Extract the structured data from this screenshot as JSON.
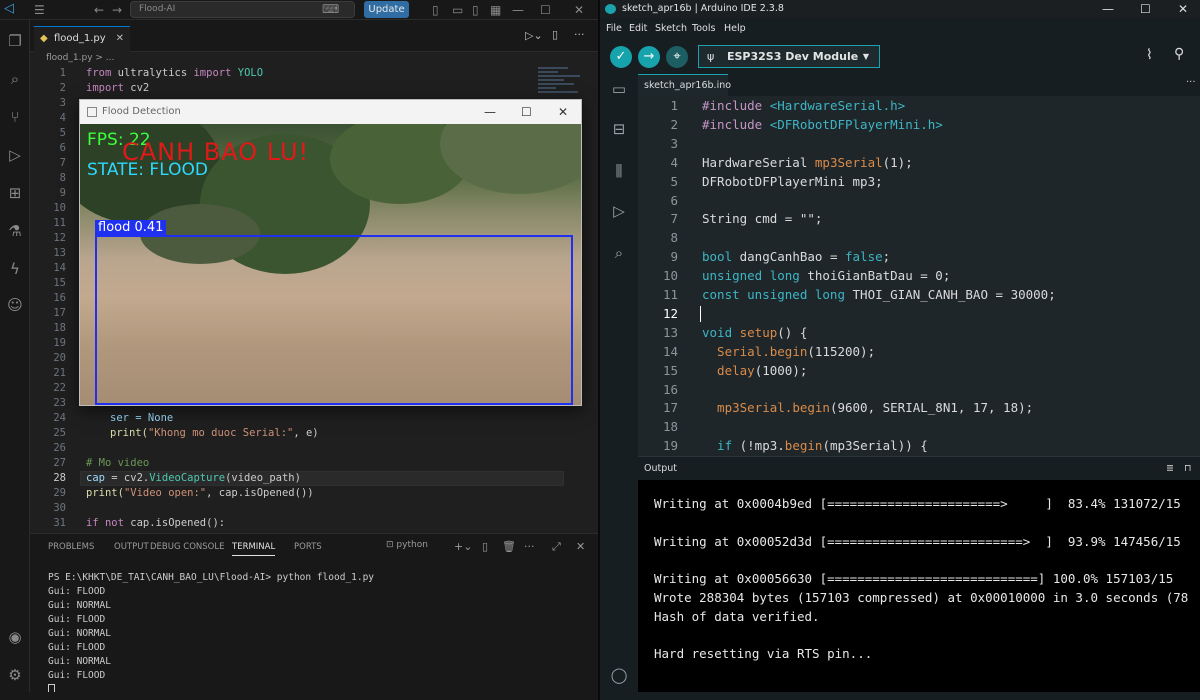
{
  "vscode": {
    "search_placeholder": "Flood-AI",
    "update_label": "Update",
    "tab_label": "flood_1.py",
    "breadcrumb": "flood_1.py > ...",
    "code_top": [
      {
        "n": "1",
        "t": "from ultralytics import YOLO"
      },
      {
        "n": "2",
        "t": "import cv2"
      },
      {
        "n": "3",
        "t": ""
      },
      {
        "n": "4",
        "t": ""
      },
      {
        "n": "5",
        "t": ""
      },
      {
        "n": "6",
        "t": ""
      },
      {
        "n": "7",
        "t": ""
      },
      {
        "n": "8",
        "t": ""
      },
      {
        "n": "9",
        "t": ""
      },
      {
        "n": "10",
        "t": ""
      },
      {
        "n": "11",
        "t": ""
      },
      {
        "n": "12",
        "t": ""
      },
      {
        "n": "13",
        "t": ""
      },
      {
        "n": "14",
        "t": ""
      },
      {
        "n": "15",
        "t": ""
      },
      {
        "n": "16",
        "t": ""
      },
      {
        "n": "17",
        "t": ""
      },
      {
        "n": "18",
        "t": ""
      },
      {
        "n": "19",
        "t": ""
      },
      {
        "n": "20",
        "t": ""
      },
      {
        "n": "21",
        "t": ""
      },
      {
        "n": "22",
        "t": ""
      },
      {
        "n": "23",
        "t": ""
      }
    ],
    "code_bottom": {
      "l24": "ser = None",
      "l25_a": "print(",
      "l25_b": "\"Khong mo duoc Serial:\"",
      "l25_c": ", e)",
      "l27": "# Mo video",
      "l28_a": "cap",
      "l28_b": " = cv2.",
      "l28_c": "VideoCapture",
      "l28_d": "(video_path)",
      "l29_a": "print(",
      "l29_b": "\"Video open:\"",
      "l29_c": ", cap.isOpened())",
      "l31_a": "if not",
      "l31_b": " cap.isOpened():"
    },
    "popup": {
      "title": "Flood Detection",
      "fps_text": "FPS: 22",
      "warning_text": "CANH BAO LU!",
      "state_text": "STATE: FLOOD",
      "box_label": "flood 0.41"
    },
    "panel_tabs": [
      "PROBLEMS",
      "OUTPUT",
      "DEBUG CONSOLE",
      "TERMINAL",
      "PORTS"
    ],
    "active_panel_tab": "TERMINAL",
    "terminal_profile": "python",
    "terminal_lines": [
      "PS E:\\KHKT\\DE_TAI\\CANH_BAO_LU\\Flood-AI> python flood_1.py",
      "Gui: FLOOD",
      "Gui: NORMAL",
      "Gui: FLOOD",
      "Gui: NORMAL",
      "Gui: FLOOD",
      "Gui: NORMAL",
      "Gui: FLOOD"
    ]
  },
  "arduino": {
    "window_title": "sketch_apr16b | Arduino IDE 2.3.8",
    "menu": [
      "File",
      "Edit",
      "Sketch",
      "Tools",
      "Help"
    ],
    "board": "ESP32S3 Dev Module",
    "tab_label": "sketch_apr16b.ino",
    "output_label": "Output",
    "code": {
      "l1_a": "#include ",
      "l1_b": "<HardwareSerial.h>",
      "l2_a": "#include ",
      "l2_b": "<DFRobotDFPlayerMini.h>",
      "l4_a": "HardwareSerial ",
      "l4_b": "mp3Serial",
      "l4_c": "(1);",
      "l5": "DFRobotDFPlayerMini mp3;",
      "l7": "String cmd = \"\";",
      "l9_a": "bool",
      "l9_b": " dangCanhBao = ",
      "l9_c": "false",
      "l9_d": ";",
      "l10_a": "unsigned long",
      "l10_b": " thoiGianBatDau = 0;",
      "l11_a": "const unsigned long",
      "l11_b": " THOI_GIAN_CANH_BAO = 30000;",
      "l13_a": "void",
      "l13_b": " setup",
      "l13_c": "() {",
      "l14_a": "  Serial",
      "l14_b": ".begin",
      "l14_c": "(115200);",
      "l15_a": "  delay",
      "l15_b": "(1000);",
      "l17_a": "  mp3Serial",
      "l17_b": ".begin",
      "l17_c": "(9600, SERIAL_8N1, 17, 18);",
      "l19_a": "  if",
      "l19_b": " (!mp3.",
      "l19_c": "begin",
      "l19_d": "(mp3Serial)) {"
    },
    "output_lines": [
      "Writing at 0x0004b9ed [=======================>     ]  83.4% 131072/15",
      "",
      "Writing at 0x00052d3d [==========================>  ]  93.9% 147456/15",
      "",
      "Writing at 0x00056630 [============================] 100.0% 157103/15",
      "Wrote 288304 bytes (157103 compressed) at 0x00010000 in 3.0 seconds (78",
      "Hash of data verified.",
      "",
      "Hard resetting via RTS pin..."
    ]
  }
}
